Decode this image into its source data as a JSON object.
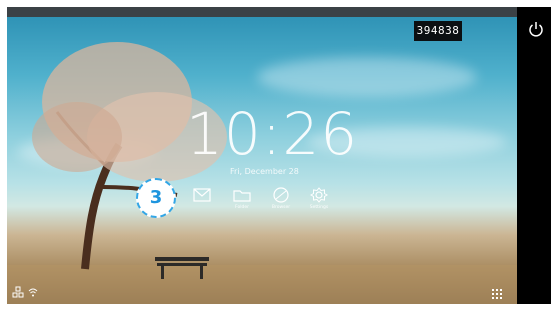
{
  "status_code": "394838",
  "clock": {
    "time": "10:26",
    "date": "Fri, December 28"
  },
  "apps": [
    {
      "icon": "mail-icon",
      "label": ""
    },
    {
      "icon": "folder-icon",
      "label": "Folder"
    },
    {
      "icon": "browser-icon",
      "label": "Browser"
    },
    {
      "icon": "settings-icon",
      "label": "Settings"
    }
  ],
  "annotation": {
    "number": "3"
  },
  "colors": {
    "badge_border": "#33a6e6",
    "badge_text": "#1e95de",
    "side_panel": "#000000"
  }
}
